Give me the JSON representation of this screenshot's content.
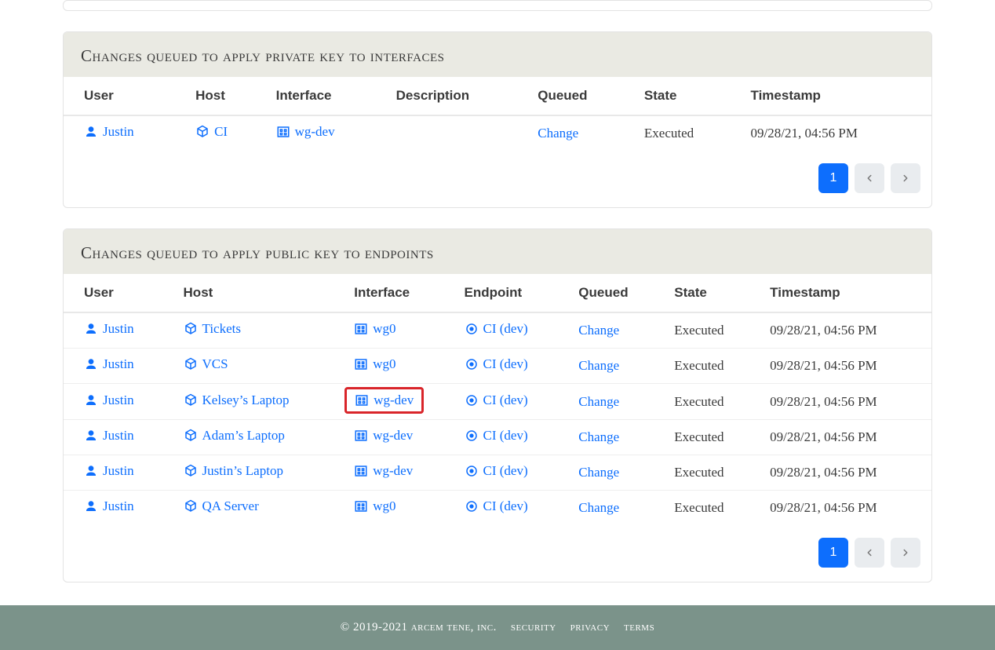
{
  "colors": {
    "link": "#0d6efd",
    "highlight_border": "#d9252a",
    "footer_bg": "#7b938a",
    "header_bg": "#eaeae3"
  },
  "panel_a": {
    "title": "changes queued to apply private key to interfaces",
    "columns": [
      "User",
      "Host",
      "Interface",
      "Description",
      "Queued",
      "State",
      "Timestamp"
    ],
    "rows": [
      {
        "user": "Justin",
        "host": "CI",
        "interface": "wg-dev",
        "description": "",
        "queued": "Change",
        "state": "Executed",
        "timestamp": "09/28/21, 04:56 PM"
      }
    ],
    "pagination": {
      "current": "1"
    }
  },
  "panel_b": {
    "title": "changes queued to apply public key to endpoints",
    "columns": [
      "User",
      "Host",
      "Interface",
      "Endpoint",
      "Queued",
      "State",
      "Timestamp"
    ],
    "rows": [
      {
        "user": "Justin",
        "host": "Tickets",
        "interface": "wg0",
        "endpoint": "CI (dev)",
        "queued": "Change",
        "state": "Executed",
        "timestamp": "09/28/21, 04:56 PM",
        "highlight": false
      },
      {
        "user": "Justin",
        "host": "VCS",
        "interface": "wg0",
        "endpoint": "CI (dev)",
        "queued": "Change",
        "state": "Executed",
        "timestamp": "09/28/21, 04:56 PM",
        "highlight": false
      },
      {
        "user": "Justin",
        "host": "Kelsey’s Laptop",
        "interface": "wg-dev",
        "endpoint": "CI (dev)",
        "queued": "Change",
        "state": "Executed",
        "timestamp": "09/28/21, 04:56 PM",
        "highlight": true
      },
      {
        "user": "Justin",
        "host": "Adam’s Laptop",
        "interface": "wg-dev",
        "endpoint": "CI (dev)",
        "queued": "Change",
        "state": "Executed",
        "timestamp": "09/28/21, 04:56 PM",
        "highlight": false
      },
      {
        "user": "Justin",
        "host": "Justin’s Laptop",
        "interface": "wg-dev",
        "endpoint": "CI (dev)",
        "queued": "Change",
        "state": "Executed",
        "timestamp": "09/28/21, 04:56 PM",
        "highlight": false
      },
      {
        "user": "Justin",
        "host": "QA Server",
        "interface": "wg0",
        "endpoint": "CI (dev)",
        "queued": "Change",
        "state": "Executed",
        "timestamp": "09/28/21, 04:56 PM",
        "highlight": false
      }
    ],
    "pagination": {
      "current": "1"
    }
  },
  "footer": {
    "copyright": "© 2019-2021 arcem tene, inc.",
    "links": [
      "security",
      "privacy",
      "terms"
    ]
  }
}
